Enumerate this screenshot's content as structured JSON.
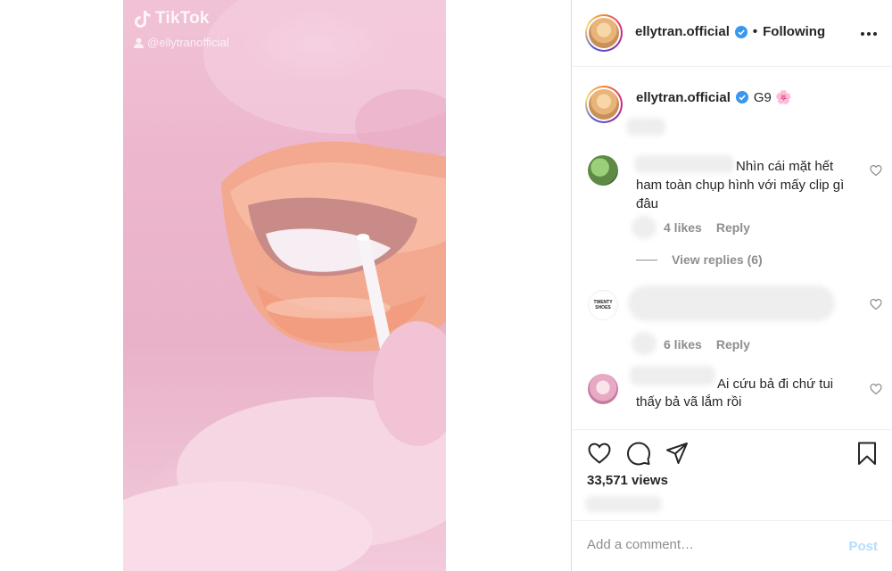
{
  "video": {
    "watermark_app": "TikTok",
    "watermark_handle": "@ellytranofficial"
  },
  "header": {
    "username": "ellytran.official",
    "verified_icon": "verified-badge-icon",
    "separator": "•",
    "follow_status": "Following",
    "more_icon": "more-options-icon"
  },
  "caption": {
    "username": "ellytran.official",
    "text": "G9 🌸"
  },
  "comments": [
    {
      "text_line1": "Nhìn cái mặt hết",
      "text_rest": "ham toàn chụp hình với mấy clip gì đâu",
      "likes": "4 likes",
      "reply": "Reply",
      "view_replies": "View replies (6)"
    },
    {
      "avatar_text": "TWENTY SHOES",
      "likes": "6 likes",
      "reply": "Reply"
    },
    {
      "text_line1": "Ai cứu bả đi chứ tui",
      "text_rest": "thấy bả vã lắm rồi"
    }
  ],
  "actions": {
    "like_icon": "heart-icon",
    "comment_icon": "comment-icon",
    "share_icon": "share-icon",
    "save_icon": "bookmark-icon",
    "views": "33,571 views"
  },
  "add_comment": {
    "placeholder": "Add a comment…",
    "post_label": "Post"
  },
  "colors": {
    "link_blue": "#0095f6",
    "post_disabled": "#b2dffc",
    "muted": "#8e8e8e",
    "verified": "#3897f0"
  }
}
